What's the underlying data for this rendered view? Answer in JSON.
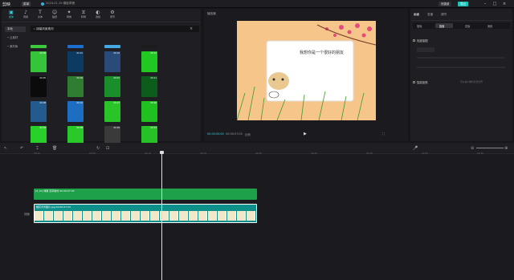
{
  "app": {
    "name": "剪映",
    "menu": "菜单",
    "project_title": "2024.01.19 模板草稿",
    "shortcut": "快捷键",
    "export": "导出"
  },
  "toolbar": [
    {
      "icon": "media-icon",
      "label": "媒体"
    },
    {
      "icon": "audio-icon",
      "label": "音频"
    },
    {
      "icon": "text-icon",
      "label": "文本"
    },
    {
      "icon": "sticker-icon",
      "label": "贴纸"
    },
    {
      "icon": "effects-icon",
      "label": "特效"
    },
    {
      "icon": "transition-icon",
      "label": "转场"
    },
    {
      "icon": "filter-icon",
      "label": "滤镜"
    },
    {
      "icon": "adjust-icon",
      "label": "调节"
    }
  ],
  "sidebar": {
    "items": [
      "本地",
      "• 云素材",
      "• 素材库"
    ]
  },
  "search": {
    "value": "绿幕风景素材"
  },
  "thumbs": [
    {
      "color": "#3cc93c",
      "duration": ""
    },
    {
      "color": "#1a6fd0",
      "duration": ""
    },
    {
      "color": "#45a8e0",
      "duration": ""
    },
    {
      "color": "#1c1c1c",
      "duration": ""
    },
    {
      "color": "#35c43a",
      "duration": "00:06"
    },
    {
      "color": "#0d3a62",
      "duration": "00:15"
    },
    {
      "color": "#2a4a7a",
      "duration": "00:10"
    },
    {
      "color": "#22c822",
      "duration": "00:12"
    },
    {
      "color": "#0b0b0b",
      "duration": "00:05"
    },
    {
      "color": "#2f7d30",
      "duration": "00:09"
    },
    {
      "color": "#1b8e2c",
      "duration": "00:07"
    },
    {
      "color": "#0c5d1c",
      "duration": "00:11"
    },
    {
      "color": "#235b8e",
      "duration": "00:08"
    },
    {
      "color": "#1d6ec2",
      "duration": "00:10"
    },
    {
      "color": "#28c428",
      "duration": "00:07"
    },
    {
      "color": "#20c020",
      "duration": "00:06"
    },
    {
      "color": "#2ad02a",
      "duration": "00:10"
    },
    {
      "color": "#2ac92a",
      "duration": "00:08"
    },
    {
      "color": "#3a3a3a",
      "duration": "00:09"
    },
    {
      "color": "#26c126",
      "duration": "00:12"
    }
  ],
  "player": {
    "title": "播放器",
    "current": "00:00:00:00",
    "total": "00:00:07:03",
    "ratio": "比例"
  },
  "rightpanel": {
    "tabs": [
      "画面",
      "变速",
      "调节"
    ],
    "subtabs": [
      "基础",
      "抠像",
      "蒙版",
      "美颜"
    ],
    "opt1": "色度抠图",
    "opt2": "智能抠像",
    "opt2_hint": "可以将人物与背景分开"
  },
  "timeline": {
    "ticks": [
      "00:00",
      "00:05",
      "00:10",
      "00:15",
      "00:20",
      "00:25",
      "00:30",
      "00:35",
      "00:40"
    ],
    "green_clip": "[4_1k] 绿幕 花草素材  00:00:07:03",
    "main_clip": "樱花背景图片.jpg  00:00:07:03",
    "cover": "封面"
  },
  "card_text": "我想你是一个很好的朋友"
}
